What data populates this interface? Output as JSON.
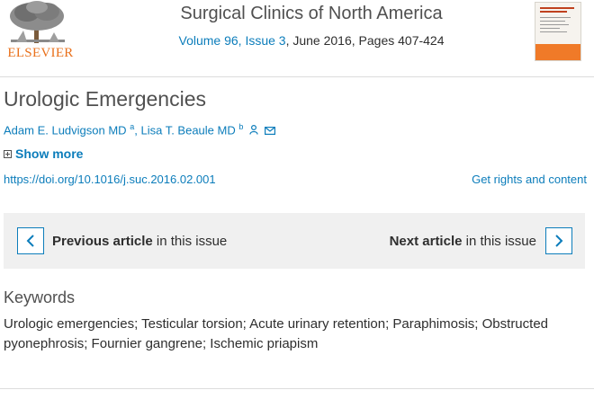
{
  "publisher": {
    "logo_text": "ELSEVIER"
  },
  "journal": {
    "title": "Surgical Clinics of North America",
    "volume_issue": "Volume 96, Issue 3",
    "date_pages": ", June 2016, Pages 407-424",
    "cover_title": "Practical Urology for the General Surgeon"
  },
  "article": {
    "title": "Urologic Emergencies",
    "authors": [
      {
        "name": "Adam E. Ludvigson MD",
        "sup": "a"
      },
      {
        "name": "Lisa T. Beaule MD",
        "sup": "b"
      }
    ],
    "author_separator": ",",
    "show_more": "Show more",
    "doi": "https://doi.org/10.1016/j.suc.2016.02.001",
    "rights": "Get rights and content"
  },
  "navigation": {
    "previous_bold": "Previous article",
    "previous_rest": " in this issue",
    "next_bold": "Next article",
    "next_rest": " in this issue"
  },
  "keywords": {
    "heading": "Keywords",
    "text": "Urologic emergencies; Testicular torsion; Acute urinary retention; Paraphimosis; Obstructed pyonephrosis; Fournier gangrene; Ischemic priapism"
  },
  "icons": {
    "author": "person-icon",
    "email": "envelope-icon",
    "previous": "chevron-left-icon",
    "next": "chevron-right-icon",
    "expand": "plus-box-icon"
  },
  "colors": {
    "link": "#0c7dbb",
    "elsevier_orange": "#e9711c",
    "text": "#2e2e2e",
    "panel_bg": "#f0f0f0"
  }
}
